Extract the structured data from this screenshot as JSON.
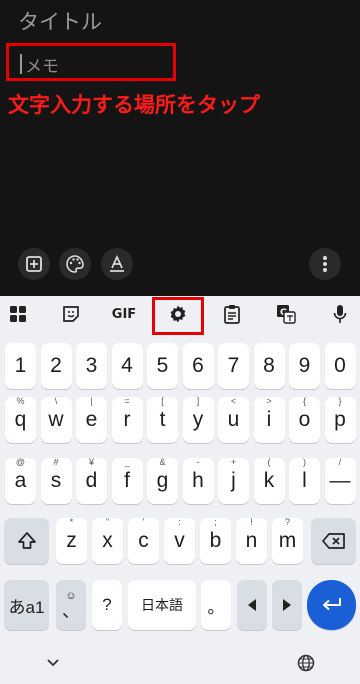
{
  "app": {
    "title_placeholder": "タイトル",
    "memo_placeholder": "メモ",
    "annotation": "文字入力する場所をタップ"
  },
  "bottom_toolbar": {
    "icons": [
      "add-box-icon",
      "palette-icon",
      "text-format-icon",
      "more-vert-icon"
    ]
  },
  "keyboard_toolbar": {
    "gif_label": "GIF",
    "icons": [
      "apps-grid-icon",
      "sticker-icon",
      "gif-icon",
      "gear-icon",
      "clipboard-icon",
      "translate-icon",
      "mic-icon"
    ]
  },
  "keyboard": {
    "numbers": [
      "1",
      "2",
      "3",
      "4",
      "5",
      "6",
      "7",
      "8",
      "9",
      "0"
    ],
    "row1": [
      {
        "k": "q",
        "h": "%"
      },
      {
        "k": "w",
        "h": "\\"
      },
      {
        "k": "e",
        "h": "|"
      },
      {
        "k": "r",
        "h": "="
      },
      {
        "k": "t",
        "h": "["
      },
      {
        "k": "y",
        "h": "]"
      },
      {
        "k": "u",
        "h": "<"
      },
      {
        "k": "i",
        "h": ">"
      },
      {
        "k": "o",
        "h": "{"
      },
      {
        "k": "p",
        "h": "}"
      }
    ],
    "row2": [
      {
        "k": "a",
        "h": "@"
      },
      {
        "k": "s",
        "h": "#"
      },
      {
        "k": "d",
        "h": "¥"
      },
      {
        "k": "f",
        "h": "_"
      },
      {
        "k": "g",
        "h": "&"
      },
      {
        "k": "h",
        "h": "-"
      },
      {
        "k": "j",
        "h": "+"
      },
      {
        "k": "k",
        "h": "("
      },
      {
        "k": "l",
        "h": ")"
      },
      {
        "k": "—",
        "h": "/"
      }
    ],
    "row3": [
      {
        "k": "z",
        "h": "*"
      },
      {
        "k": "x",
        "h": "\""
      },
      {
        "k": "c",
        "h": "'"
      },
      {
        "k": "v",
        "h": ":"
      },
      {
        "k": "b",
        "h": ";"
      },
      {
        "k": "n",
        "h": "!"
      },
      {
        "k": "m",
        "h": "?"
      }
    ],
    "lang_key": "あa1",
    "emoji_comma": "、",
    "question": "?",
    "space": "日本語",
    "period": "。",
    "enter_icon": "enter-icon"
  },
  "nav": {
    "icons": [
      "chevron-down-icon",
      "globe-icon"
    ]
  },
  "colors": {
    "highlight": "#e60000",
    "annotation": "#ff1a1a",
    "enter_key": "#1a5fd6",
    "keyboard_bg": "#eef0f3",
    "app_bg": "#141414"
  }
}
